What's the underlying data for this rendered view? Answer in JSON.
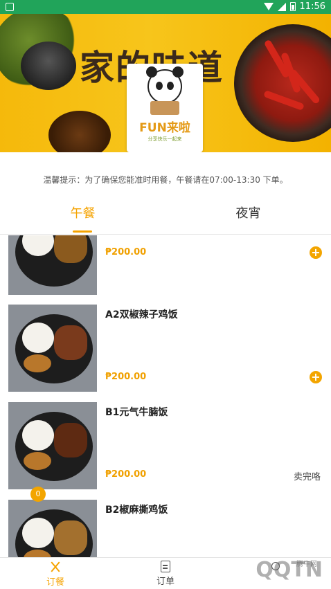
{
  "status_bar": {
    "time": "11:56"
  },
  "banner": {
    "title": "家的味道",
    "logo_text": "FUN来啦",
    "logo_subtitle": "分享快乐一起来"
  },
  "notice": "温馨提示：为了确保您能准时用餐，午餐请在07:00-13:30 下单。",
  "tabs": [
    {
      "label": "午餐",
      "active": true
    },
    {
      "label": "夜宵",
      "active": false
    }
  ],
  "menu_items": [
    {
      "name": "",
      "price": "₱200.00",
      "action": "add"
    },
    {
      "name": "A2双椒辣子鸡饭",
      "price": "₱200.00",
      "action": "add"
    },
    {
      "name": "B1元气牛腩饭",
      "price": "₱200.00",
      "action": "soldout",
      "status": "卖完咯"
    },
    {
      "name": "B2椒麻撕鸡饭",
      "price": "",
      "action": "none"
    }
  ],
  "cart": {
    "count": "0"
  },
  "bottom_nav": [
    {
      "label": "订餐",
      "icon": "cutlery-icon",
      "active": true
    },
    {
      "label": "订单",
      "icon": "document-icon",
      "active": false
    },
    {
      "label": "",
      "icon": "user-icon",
      "active": false
    }
  ],
  "watermark": {
    "text": "QQTN",
    "site": "腾牛网"
  },
  "colors": {
    "accent": "#f5a300",
    "status_bar": "#21a45a"
  }
}
